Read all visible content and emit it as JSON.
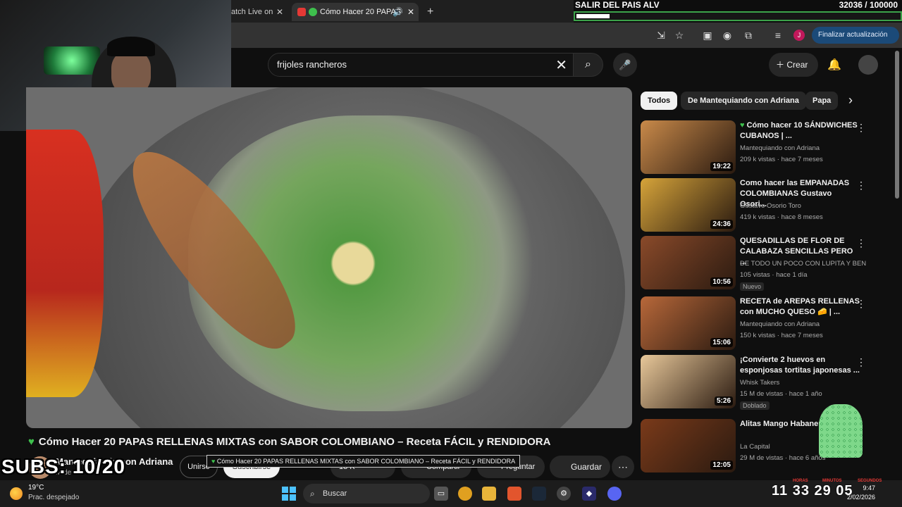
{
  "browser": {
    "tab1_label": "atch Live on",
    "tab2_label": "Cómo Hacer 20 PAPAS",
    "new_tab": "+",
    "update_button": "Finalizar actualización",
    "profile_initial": "J"
  },
  "goal": {
    "title": "SALIR DEL PAIS ALV",
    "count": "32036 / 100000",
    "progress": 0.32
  },
  "youtube": {
    "search_value": "frijoles rancheros",
    "create_label": "Crear",
    "video_title": "Cómo Hacer 20 PAPAS RELLENAS MIXTAS con SABOR COLOMBIANO – Receta FÁCIL y RENDIDORA",
    "channel_name": "Mantequiando con Adriana",
    "channel_subs": "M de su",
    "join_label": "Unirse",
    "subscribe_label": "Suscribirse",
    "pill_like": "13 K",
    "pill_share": "Compartir",
    "pill_ask": "Preguntar",
    "save_label": "Guardar",
    "tooltip": "Cómo Hacer 20 PAPAS RELLENAS MIXTAS con SABOR COLOMBIANO – Receta FÁCIL y RENDIDORA"
  },
  "chips": [
    "Todos",
    "De Mantequiando con Adriana",
    "Papa"
  ],
  "recommendations": [
    {
      "title": "Cómo hacer 10 SÁNDWICHES CUBANOS | ...",
      "channel": "Mantequiando con Adriana",
      "meta": "209 k vistas · hace 7 meses",
      "duration": "19:22",
      "heart": true,
      "badge": ""
    },
    {
      "title": "Como hacer las EMPANADAS COLOMBIANAS Gustavo Osori...",
      "channel": "Gustavo Osorio Toro",
      "meta": "419 k vistas · hace 8 meses",
      "duration": "24:36",
      "heart": false,
      "badge": ""
    },
    {
      "title": "QUESADILLAS DE FLOR DE CALABAZA SENCILLAS PERO ...",
      "channel": "DE TODO UN POCO CON LUPITA Y BENI...",
      "meta": "105 vistas · hace 1 día",
      "duration": "10:56",
      "heart": false,
      "badge": "Nuevo"
    },
    {
      "title": "RECETA de AREPAS RELLENAS con MUCHO QUESO 🧀 | ...",
      "channel": "Mantequiando con Adriana",
      "meta": "150 k vistas · hace 7 meses",
      "duration": "15:06",
      "heart": false,
      "badge": ""
    },
    {
      "title": "¡Convierte 2 huevos en esponjosas tortitas japonesas ...",
      "channel": "Whisk Takers",
      "meta": "15 M de vistas · hace 1 año",
      "duration": "5:26",
      "heart": false,
      "badge": "Doblado"
    },
    {
      "title": "Alitas Mango Habanero Capital",
      "channel": "La Capital",
      "meta": "29 M de vistas · hace 6 años",
      "duration": "12:05",
      "heart": false,
      "badge": ""
    }
  ],
  "thumb_colors": [
    "#c98a4a",
    "#d6a43a",
    "#8a4a2a",
    "#b8683a",
    "#e8c89a",
    "#7a3a1a"
  ],
  "overlay": {
    "subs": "SUBS: 10/20",
    "timer": "11 33 29 05",
    "timer_labels": [
      "HORAS",
      "MINUTOS",
      "SEGUNDOS"
    ]
  },
  "taskbar": {
    "temp": "19°C",
    "weather": "Prac. despejado",
    "search": "Buscar",
    "time": "9:47",
    "date": "2/02/2026"
  },
  "colors": {
    "accent": "#3ca34a",
    "update_button": "#1b4a78",
    "chip_active": "#f1f1f1"
  }
}
